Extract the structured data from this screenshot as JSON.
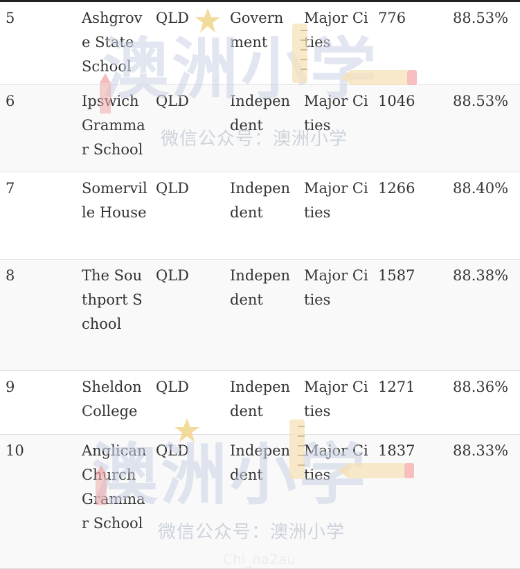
{
  "table": {
    "rows": [
      {
        "rank": "5",
        "name": "Ashgrove State School",
        "state": "QLD",
        "sector": "Government",
        "region": "Major Cities",
        "enrolment": "776",
        "score": "88.53%"
      },
      {
        "rank": "6",
        "name": "Ipswich Grammar School",
        "state": "QLD",
        "sector": "Independent",
        "region": "Major Cities",
        "enrolment": "1046",
        "score": "88.53%"
      },
      {
        "rank": "7",
        "name": "Somerville House",
        "state": "QLD",
        "sector": "Independent",
        "region": "Major Cities",
        "enrolment": "1266",
        "score": "88.40%"
      },
      {
        "rank": "8",
        "name": "The Southport School",
        "state": "QLD",
        "sector": "Independent",
        "region": "Major Cities",
        "enrolment": "1587",
        "score": "88.38%"
      },
      {
        "rank": "9",
        "name": "Sheldon College",
        "state": "QLD",
        "sector": "Independent",
        "region": "Major Cities",
        "enrolment": "1271",
        "score": "88.36%"
      },
      {
        "rank": "10",
        "name": "Anglican Church Grammar School",
        "state": "QLD",
        "sector": "Independent",
        "region": "Major Cities",
        "enrolment": "1837",
        "score": "88.33%"
      }
    ]
  },
  "watermark": {
    "logo_text": "澳洲小学",
    "subtitle": "微信公众号：澳洲小学",
    "footer": "Chi_na2au"
  }
}
